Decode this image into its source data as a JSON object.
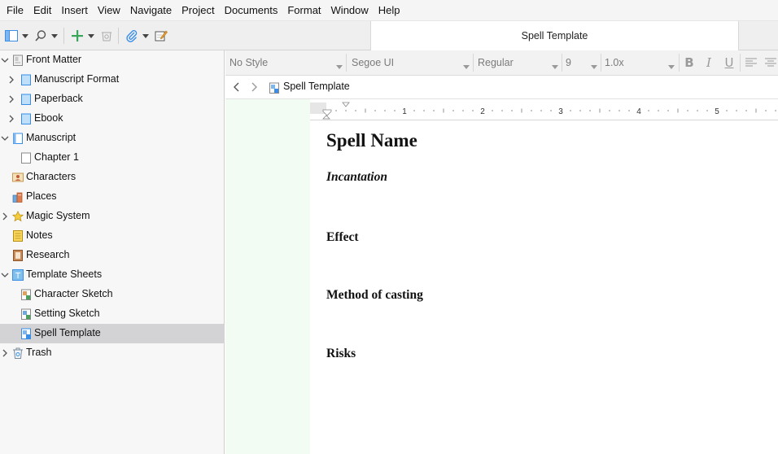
{
  "menu": [
    "File",
    "Edit",
    "Insert",
    "View",
    "Navigate",
    "Project",
    "Documents",
    "Format",
    "Window",
    "Help"
  ],
  "toolbar": {
    "document_title": "Spell Template"
  },
  "binder": {
    "items": [
      {
        "label": "Front Matter",
        "icon": "front-matter-folder-icon",
        "expanded": true,
        "indent": 0
      },
      {
        "label": "Manuscript Format",
        "icon": "blue-folder-icon",
        "expanded": false,
        "indent": 1
      },
      {
        "label": "Paperback",
        "icon": "blue-folder-icon",
        "expanded": false,
        "indent": 1
      },
      {
        "label": "Ebook",
        "icon": "blue-folder-icon",
        "expanded": false,
        "indent": 1
      },
      {
        "label": "Manuscript",
        "icon": "manuscript-icon",
        "expanded": true,
        "indent": 0
      },
      {
        "label": "Chapter 1",
        "icon": "document-icon",
        "indent": 1
      },
      {
        "label": "Characters",
        "icon": "characters-icon",
        "indent": 0
      },
      {
        "label": "Places",
        "icon": "places-icon",
        "indent": 0
      },
      {
        "label": "Magic System",
        "icon": "star-icon",
        "expanded": false,
        "indent": 0
      },
      {
        "label": "Notes",
        "icon": "notes-icon",
        "indent": 0
      },
      {
        "label": "Research",
        "icon": "research-icon",
        "indent": 0
      },
      {
        "label": "Template Sheets",
        "icon": "template-folder-icon",
        "expanded": true,
        "indent": 0
      },
      {
        "label": "Character Sketch",
        "icon": "template-sheet-icon",
        "indent": 1
      },
      {
        "label": "Setting Sketch",
        "icon": "template-sheet-icon",
        "indent": 1
      },
      {
        "label": "Spell Template",
        "icon": "template-sheet-icon",
        "indent": 1,
        "selected": true
      },
      {
        "label": "Trash",
        "icon": "trash-icon",
        "expanded": false,
        "indent": 0
      }
    ]
  },
  "format_bar": {
    "style": "No Style",
    "font": "Segoe UI",
    "weight": "Regular",
    "size": "9",
    "line_spacing": "1.0x"
  },
  "header": {
    "title": "Spell Template"
  },
  "ruler": {
    "numbers": [
      "1",
      "2",
      "3",
      "4",
      "5"
    ]
  },
  "document": {
    "title": "Spell Name",
    "subtitle": "Incantation",
    "sections": [
      "Effect",
      "Method of casting",
      "Risks"
    ]
  },
  "colors": {
    "selection": "#d3d3d6",
    "editor_margin": "#f2fcf2",
    "accent_blue": "#3a8ee6",
    "add_green": "#3aa65a"
  }
}
